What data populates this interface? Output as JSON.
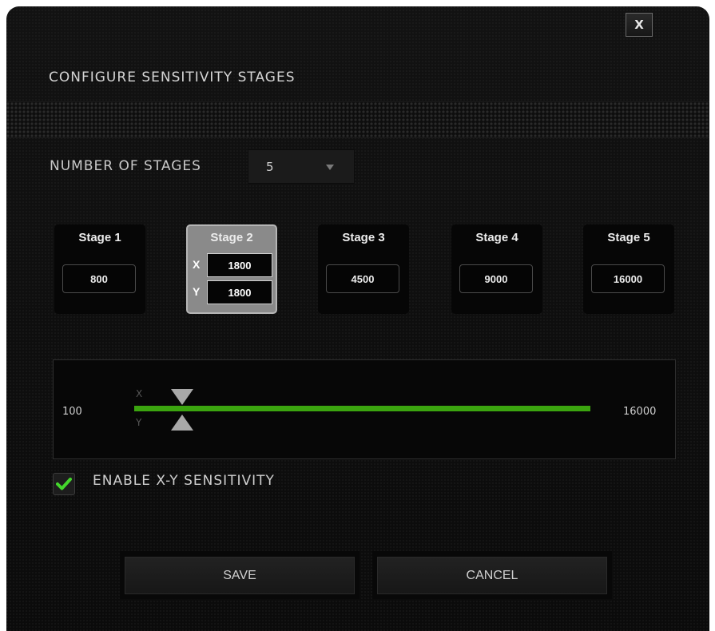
{
  "dialog": {
    "title": "CONFIGURE SENSITIVITY STAGES",
    "close_label": "X"
  },
  "stages_count": {
    "label": "NUMBER OF STAGES",
    "value": "5"
  },
  "stages": [
    {
      "name": "Stage 1",
      "value": "800"
    },
    {
      "name": "Stage 2",
      "x_label": "X",
      "x_value": "1800",
      "y_label": "Y",
      "y_value": "1800",
      "active": true
    },
    {
      "name": "Stage 3",
      "value": "4500"
    },
    {
      "name": "Stage 4",
      "value": "9000"
    },
    {
      "name": "Stage 5",
      "value": "16000"
    }
  ],
  "slider": {
    "min_label": "100",
    "max_label": "16000",
    "x_axis_label": "X",
    "y_axis_label": "Y",
    "x_value": 1800,
    "y_value": 1800,
    "min": 100,
    "max": 16000,
    "track_color": "#3ba40f"
  },
  "xy_sensitivity": {
    "label": "ENABLE X-Y SENSITIVITY",
    "checked": true,
    "check_color": "#44d62c"
  },
  "buttons": {
    "save": "SAVE",
    "cancel": "CANCEL"
  }
}
